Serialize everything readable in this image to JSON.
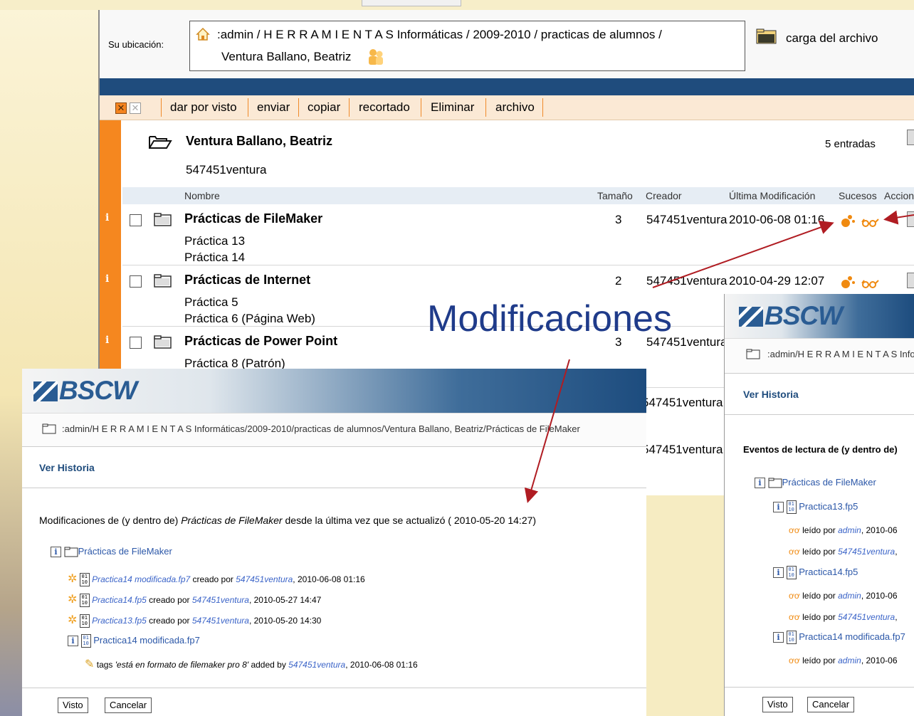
{
  "main": {
    "location_label": "Su ubicación:",
    "path_line1": ":admin / H E R R A M I E N T A S Informáticas / 2009-2010 / practicas de alumnos /",
    "path_line2": "Ventura Ballano, Beatriz",
    "upload_label": "carga del archivo",
    "toolbar": [
      "dar por visto",
      "enviar",
      "copiar",
      "recortado",
      "Eliminar",
      "archivo"
    ],
    "folder_title": "Ventura Ballano, Beatriz",
    "entries": "5 entradas",
    "owner": "547451ventura",
    "columns": {
      "name": "Nombre",
      "size": "Tamaño",
      "creator": "Creador",
      "modified": "Última Modificación",
      "events": "Sucesos",
      "actions": "Acciones"
    },
    "rows": [
      {
        "name": "Prácticas de FileMaker",
        "desc1": "Práctica 13",
        "desc2": "Práctica 14",
        "size": "3",
        "creator": "547451ventura",
        "date": "2010-06-08 01:16"
      },
      {
        "name": "Prácticas de Internet",
        "desc1": "Práctica 5",
        "desc2": "Práctica 6 (Página Web)",
        "size": "2",
        "creator": "547451ventura",
        "date": "2010-04-29 12:07"
      },
      {
        "name": "Prácticas de Power Point",
        "desc1": "Práctica 8 (Patrón)",
        "desc2": "",
        "size": "3",
        "creator": "547451ventura",
        "date": ""
      }
    ],
    "extra_creators": [
      "547451ventura",
      "547451ventura"
    ]
  },
  "annotation": "Modificaciones",
  "left_window": {
    "logo": "BSCW",
    "path": ":admin/H E R R A M I E N T A S Informáticas/2009-2010/practicas de alumnos/Ventura Ballano, Beatriz/Prácticas de FileMaker",
    "ver_historia": "Ver Historia",
    "header_prefix": "Modificaciones de (y dentro de) ",
    "header_folder": "Prácticas de FileMaker",
    "header_suffix": " desde la última vez que se actualizó ( 2010-05-20 14:27)",
    "folder": "Prácticas de FileMaker",
    "events": [
      {
        "file": "Practica14 modificada.fp7",
        "action": " creado por ",
        "user": "547451ventura",
        "date": ", 2010-06-08 01:16"
      },
      {
        "file": "Practica14.fp5",
        "action": " creado por ",
        "user": "547451ventura",
        "date": ", 2010-05-27 14:47"
      },
      {
        "file": "Practica13.fp5",
        "action": " creado por ",
        "user": "547451ventura",
        "date": ", 2010-05-20 14:30"
      }
    ],
    "file_node": "Practica14 modificada.fp7",
    "tag_prefix": "tags ",
    "tag_value": "'está en formato de filemaker pro 8'",
    "tag_mid": " added by ",
    "tag_user": "547451ventura",
    "tag_date": ", 2010-06-08 01:16",
    "btn_ok": "Visto",
    "btn_cancel": "Cancelar"
  },
  "right_window": {
    "logo": "BSCW",
    "path": ":admin/H E R R A M I E N T A S Informáticas",
    "ver_historia": "Ver Historia",
    "header": "Eventos de lectura de (y dentro de)",
    "folder": "Prácticas de FileMaker",
    "file1": "Practica13.fp5",
    "file2": "Practica14.fp5",
    "file3": "Practica14 modificada.fp7",
    "read_label": " leído por ",
    "reads": [
      {
        "user": "admin",
        "date": ", 2010-06"
      },
      {
        "user": "547451ventura",
        "date": ","
      },
      {
        "user": "admin",
        "date": ", 2010-06"
      },
      {
        "user": "547451ventura",
        "date": ","
      },
      {
        "user": "admin",
        "date": ", 2010-06"
      }
    ],
    "btn_ok": "Visto",
    "btn_cancel": "Cancelar"
  },
  "colors": {
    "accent": "#f5871f",
    "bluebar": "#1f4c7d",
    "arrow": "#b01c22",
    "annotation": "#1f3b8a"
  }
}
